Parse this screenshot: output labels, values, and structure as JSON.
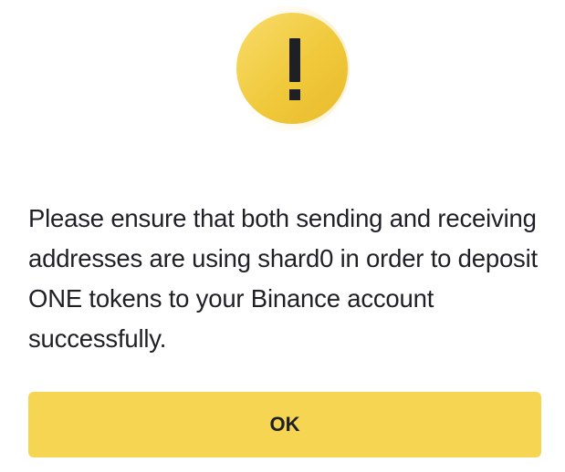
{
  "dialog": {
    "icon": "warning-exclamation-icon",
    "message": "Please ensure that both sending and receiving addresses are using shard0 in order to deposit ONE tokens to your Binance account successfully.",
    "ok_label": "OK"
  },
  "colors": {
    "accent": "#f5d551",
    "icon_yellow": "#f0c93b",
    "text": "#1e2026",
    "background": "#ffffff"
  }
}
